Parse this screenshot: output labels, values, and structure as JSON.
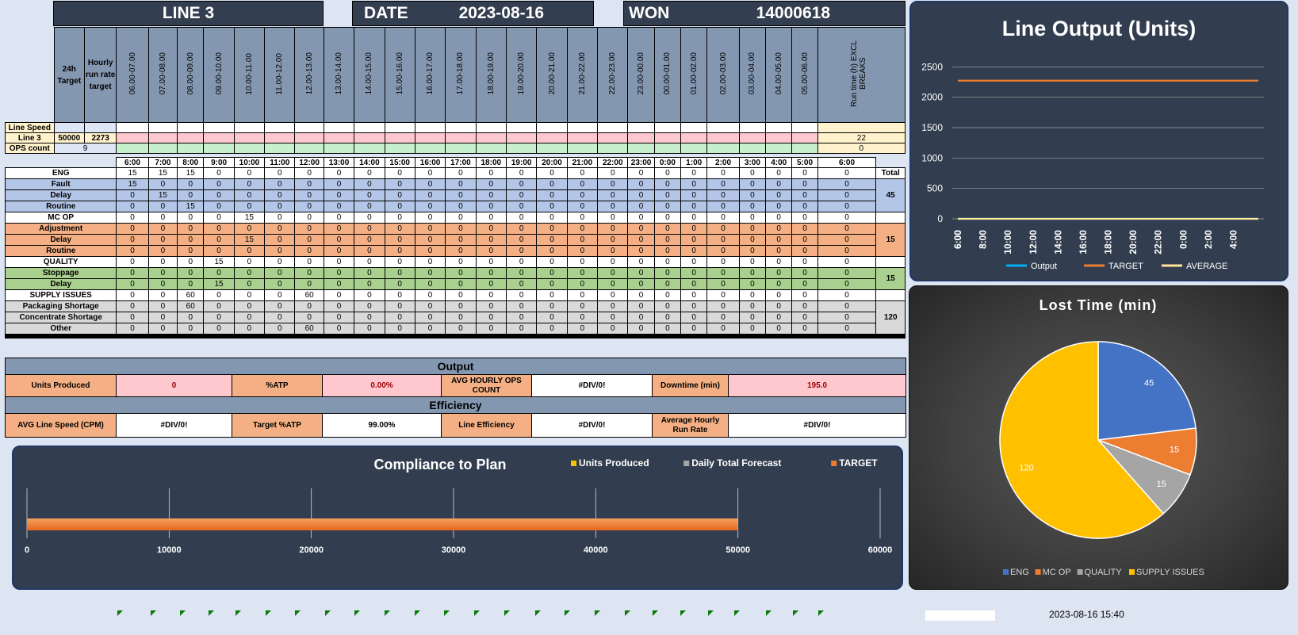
{
  "header": {
    "line_label": "LINE 3",
    "date_label": "DATE",
    "date_value": "2023-08-16",
    "won_label": "WON",
    "won_value": "14000618"
  },
  "columns": {
    "target_24h": "24h Target",
    "hourly_target": "Hourly run rate target",
    "slots": [
      "06.00-07.00",
      "07.00-08.00",
      "08.00-09.00",
      "09.00-10.00",
      "10.00-11.00",
      "11.00-12.00",
      "12.00-13.00",
      "13.00-14.00",
      "14.00-15.00",
      "15.00-16.00",
      "16.00-17.00",
      "17.00-18.00",
      "18.00-19.00",
      "19.00-20.00",
      "20.00-21.00",
      "21.00-22.00",
      "22.00-23.00",
      "23.00-00.00",
      "00.00-01.00",
      "01.00-02.00",
      "02.00-03.00",
      "03.00-04.00",
      "04.00-05.00",
      "05.00-06.00"
    ],
    "runtime": "Run time (h) EXCL BREAKS"
  },
  "top_rows": {
    "line_speed_label": "Line Speed",
    "line3_label": "Line 3",
    "line3_target": "50000",
    "line3_hourly": "2273",
    "line3_runtime": "22",
    "ops_label": "OPS count",
    "ops_value": "9",
    "ops_runtime": "0"
  },
  "times": [
    "6:00",
    "7:00",
    "8:00",
    "9:00",
    "10:00",
    "11:00",
    "12:00",
    "13:00",
    "14:00",
    "15:00",
    "16:00",
    "17:00",
    "18:00",
    "19:00",
    "20:00",
    "21:00",
    "22:00",
    "23:00",
    "0:00",
    "1:00",
    "2:00",
    "3:00",
    "4:00",
    "5:00",
    "6:00"
  ],
  "total_label": "Total",
  "loss_rows": [
    {
      "label": "ENG",
      "group": "white",
      "values": [
        "15",
        "15",
        "15",
        "0",
        "0",
        "0",
        "0",
        "0",
        "0",
        "0",
        "0",
        "0",
        "0",
        "0",
        "0",
        "0",
        "0",
        "0",
        "0",
        "0",
        "0",
        "0",
        "0",
        "0",
        "0"
      ]
    },
    {
      "label": "Fault",
      "group": "blue",
      "values": [
        "15",
        "0",
        "0",
        "0",
        "0",
        "0",
        "0",
        "0",
        "0",
        "0",
        "0",
        "0",
        "0",
        "0",
        "0",
        "0",
        "0",
        "0",
        "0",
        "0",
        "0",
        "0",
        "0",
        "0",
        "0"
      ]
    },
    {
      "label": "Delay",
      "group": "blue",
      "values": [
        "0",
        "15",
        "0",
        "0",
        "0",
        "0",
        "0",
        "0",
        "0",
        "0",
        "0",
        "0",
        "0",
        "0",
        "0",
        "0",
        "0",
        "0",
        "0",
        "0",
        "0",
        "0",
        "0",
        "0",
        "0"
      ]
    },
    {
      "label": "Routine",
      "group": "blue",
      "values": [
        "0",
        "0",
        "15",
        "0",
        "0",
        "0",
        "0",
        "0",
        "0",
        "0",
        "0",
        "0",
        "0",
        "0",
        "0",
        "0",
        "0",
        "0",
        "0",
        "0",
        "0",
        "0",
        "0",
        "0",
        "0"
      ]
    },
    {
      "label": "MC OP",
      "group": "white",
      "values": [
        "0",
        "0",
        "0",
        "0",
        "15",
        "0",
        "0",
        "0",
        "0",
        "0",
        "0",
        "0",
        "0",
        "0",
        "0",
        "0",
        "0",
        "0",
        "0",
        "0",
        "0",
        "0",
        "0",
        "0",
        "0"
      ]
    },
    {
      "label": "Adjustment",
      "group": "orange",
      "values": [
        "0",
        "0",
        "0",
        "0",
        "0",
        "0",
        "0",
        "0",
        "0",
        "0",
        "0",
        "0",
        "0",
        "0",
        "0",
        "0",
        "0",
        "0",
        "0",
        "0",
        "0",
        "0",
        "0",
        "0",
        "0"
      ]
    },
    {
      "label": "Delay",
      "group": "orange",
      "values": [
        "0",
        "0",
        "0",
        "0",
        "15",
        "0",
        "0",
        "0",
        "0",
        "0",
        "0",
        "0",
        "0",
        "0",
        "0",
        "0",
        "0",
        "0",
        "0",
        "0",
        "0",
        "0",
        "0",
        "0",
        "0"
      ]
    },
    {
      "label": "Routine",
      "group": "orange",
      "values": [
        "0",
        "0",
        "0",
        "0",
        "0",
        "0",
        "0",
        "0",
        "0",
        "0",
        "0",
        "0",
        "0",
        "0",
        "0",
        "0",
        "0",
        "0",
        "0",
        "0",
        "0",
        "0",
        "0",
        "0",
        "0"
      ]
    },
    {
      "label": "QUALITY",
      "group": "white",
      "values": [
        "0",
        "0",
        "0",
        "15",
        "0",
        "0",
        "0",
        "0",
        "0",
        "0",
        "0",
        "0",
        "0",
        "0",
        "0",
        "0",
        "0",
        "0",
        "0",
        "0",
        "0",
        "0",
        "0",
        "0",
        "0"
      ]
    },
    {
      "label": "Stoppage",
      "group": "green",
      "values": [
        "0",
        "0",
        "0",
        "0",
        "0",
        "0",
        "0",
        "0",
        "0",
        "0",
        "0",
        "0",
        "0",
        "0",
        "0",
        "0",
        "0",
        "0",
        "0",
        "0",
        "0",
        "0",
        "0",
        "0",
        "0"
      ]
    },
    {
      "label": "Delay",
      "group": "green",
      "values": [
        "0",
        "0",
        "0",
        "15",
        "0",
        "0",
        "0",
        "0",
        "0",
        "0",
        "0",
        "0",
        "0",
        "0",
        "0",
        "0",
        "0",
        "0",
        "0",
        "0",
        "0",
        "0",
        "0",
        "0",
        "0"
      ]
    },
    {
      "label": "SUPPLY ISSUES",
      "group": "white",
      "values": [
        "0",
        "0",
        "60",
        "0",
        "0",
        "0",
        "60",
        "0",
        "0",
        "0",
        "0",
        "0",
        "0",
        "0",
        "0",
        "0",
        "0",
        "0",
        "0",
        "0",
        "0",
        "0",
        "0",
        "0",
        "0"
      ]
    },
    {
      "label": "Packaging Shortage",
      "group": "gray",
      "values": [
        "0",
        "0",
        "60",
        "0",
        "0",
        "0",
        "0",
        "0",
        "0",
        "0",
        "0",
        "0",
        "0",
        "0",
        "0",
        "0",
        "0",
        "0",
        "0",
        "0",
        "0",
        "0",
        "0",
        "0",
        "0"
      ]
    },
    {
      "label": "Concentrate Shortage",
      "group": "gray",
      "values": [
        "0",
        "0",
        "0",
        "0",
        "0",
        "0",
        "0",
        "0",
        "0",
        "0",
        "0",
        "0",
        "0",
        "0",
        "0",
        "0",
        "0",
        "0",
        "0",
        "0",
        "0",
        "0",
        "0",
        "0",
        "0"
      ]
    },
    {
      "label": "Other",
      "group": "gray",
      "values": [
        "0",
        "0",
        "0",
        "0",
        "0",
        "0",
        "60",
        "0",
        "0",
        "0",
        "0",
        "0",
        "0",
        "0",
        "0",
        "0",
        "0",
        "0",
        "0",
        "0",
        "0",
        "0",
        "0",
        "0",
        "0"
      ]
    }
  ],
  "group_totals": {
    "blue": "45",
    "orange": "15",
    "green": "15",
    "gray": "120"
  },
  "output": {
    "title": "Output",
    "units_label": "Units Produced",
    "units_value": "0",
    "atp_label": "%ATP",
    "atp_value": "0.00%",
    "avg_ops_label": "AVG HOURLY OPS COUNT",
    "avg_ops_value": "#DIV/0!",
    "downtime_label": "Downtime (min)",
    "downtime_value": "195.0"
  },
  "efficiency": {
    "title": "Efficiency",
    "speed_label": "AVG Line Speed (CPM)",
    "speed_value": "#DIV/0!",
    "target_atp_label": "Target %ATP",
    "target_atp_value": "99.00%",
    "line_eff_label": "Line Efficiency",
    "line_eff_value": "#DIV/0!",
    "avg_run_label": "Average Hourly Run Rate",
    "avg_run_value": "#DIV/0!"
  },
  "timestamp": "2023-08-16 15:40",
  "colors": {
    "navy": "#333f50",
    "orange": "#ed7d31",
    "blue": "#4472c4",
    "gray": "#a5a5a5",
    "yellow": "#ffc000",
    "lightblue": "#00b0f0",
    "cream": "#ffe699"
  },
  "chart_data": [
    {
      "type": "line",
      "title": "Line Output (Units)",
      "x": [
        "6:00",
        "7:00",
        "8:00",
        "9:00",
        "10:00",
        "11:00",
        "12:00",
        "13:00",
        "14:00",
        "15:00",
        "16:00",
        "17:00",
        "18:00",
        "19:00",
        "20:00",
        "21:00",
        "22:00",
        "23:00",
        "0:00",
        "1:00",
        "2:00",
        "3:00",
        "4:00",
        "5:00",
        "6:00"
      ],
      "xticks": [
        "6:00",
        "8:00",
        "10:00",
        "12:00",
        "14:00",
        "16:00",
        "18:00",
        "20:00",
        "22:00",
        "0:00",
        "2:00",
        "4:00",
        "6:00"
      ],
      "yticks": [
        "0",
        "500",
        "1000",
        "1500",
        "2000",
        "2500"
      ],
      "ylim": [
        0,
        2700
      ],
      "series": [
        {
          "name": "Output",
          "color": "#00b0f0",
          "values": [
            0,
            0,
            0,
            0,
            0,
            0,
            0,
            0,
            0,
            0,
            0,
            0,
            0,
            0,
            0,
            0,
            0,
            0,
            0,
            0,
            0,
            0,
            0,
            0,
            0
          ]
        },
        {
          "name": "TARGET",
          "color": "#ed7d31",
          "values": [
            2273,
            2273,
            2273,
            2273,
            2273,
            2273,
            2273,
            2273,
            2273,
            2273,
            2273,
            2273,
            2273,
            2273,
            2273,
            2273,
            2273,
            2273,
            2273,
            2273,
            2273,
            2273,
            2273,
            2273,
            2273
          ]
        },
        {
          "name": "AVERAGE",
          "color": "#ffe699",
          "values": [
            0,
            0,
            0,
            0,
            0,
            0,
            0,
            0,
            0,
            0,
            0,
            0,
            0,
            0,
            0,
            0,
            0,
            0,
            0,
            0,
            0,
            0,
            0,
            0,
            0
          ]
        }
      ],
      "grid": true,
      "legend": "bottom"
    },
    {
      "type": "pie",
      "title": "Lost Time (min)",
      "categories": [
        "ENG",
        "MC OP",
        "QUALITY",
        "SUPPLY ISSUES"
      ],
      "values": [
        45,
        15,
        15,
        120
      ],
      "colors": [
        "#4472c4",
        "#ed7d31",
        "#a5a5a5",
        "#ffc000"
      ],
      "legend": "bottom"
    },
    {
      "type": "bar",
      "title": "Compliance to Plan",
      "series": [
        {
          "name": "Units Produced",
          "color": "#ffc000",
          "values": [
            0
          ]
        },
        {
          "name": "Daily Total Forecast",
          "color": "#a5a5a5",
          "values": [
            0
          ]
        },
        {
          "name": "TARGET",
          "color": "#ed7d31",
          "values": [
            50000
          ]
        }
      ],
      "xticks": [
        "0",
        "10000",
        "20000",
        "30000",
        "40000",
        "50000",
        "60000"
      ],
      "xlim": [
        0,
        60000
      ],
      "legend": "top"
    }
  ]
}
